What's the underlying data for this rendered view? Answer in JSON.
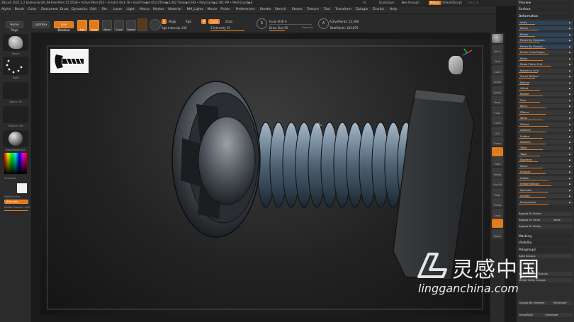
{
  "titlebar": {
    "app": "ZBrush 2021.1.2 boolean/knife_04",
    "stats": "• Free Mem 15.55GB • Active Mem 853 • Scratch Disk 78 • EvalTime▶0.653 ZTime▶1.082 Timer▶0.062 • PolyCount▶2.481 MP • MeshCount▶8",
    "quicksave": "QuickSave",
    "seethrough": "See-through",
    "seethrough_val": "0",
    "menus": "Menus",
    "default_script": "DefaultZScript"
  },
  "menu": [
    "Alpha",
    "Brush",
    "Color",
    "Document",
    "Draw",
    "Dynamics",
    "Edit",
    "File",
    "Layer",
    "Light",
    "Macro",
    "Marker",
    "Material",
    "NM_Lights",
    "Movie",
    "Picker",
    "Preferences",
    "Render",
    "Stencil",
    "Stroke",
    "Texture",
    "Tool",
    "Transform",
    "Zplugin",
    "Zscript",
    "Help"
  ],
  "coords": "-2.941,-0.111,1.456",
  "toolbar": {
    "home_page": "Home Page",
    "lightbox": "LightBox",
    "live_boolean": "Live Boolean",
    "edit": "Edit",
    "draw": "Draw",
    "move": "Move",
    "scale": "Scale",
    "rotate": "Rotate",
    "a": "A",
    "mrgb": "Mrgb",
    "rgb": "Rgb",
    "rgb_intensity": "Rgb Intensity 100",
    "m": "M",
    "zadd": "Zadd",
    "zsub": "Zsub",
    "z_intensity": "Z Intensity 15",
    "focal_shift": "Focal Shift 0",
    "draw_size": "Draw Size 55",
    "dynamic": "Dynamic",
    "active_points": "ActivePoints: 15,398",
    "total_points": "TotalPoints: 183,879"
  },
  "left": {
    "brush": "Move",
    "stroke": "Dots",
    "alpha": "Alpha Off",
    "texture": "Texture Off",
    "material": "BasicMaterial2",
    "gradient": "Gradient",
    "switch_color": "SwitchColor",
    "alternate": "Alternate",
    "model_opacity": "Model Opacity 100"
  },
  "shelf": [
    "BPR",
    "SPix 3",
    "Scroll",
    "Zoom",
    "Actual",
    "AAHalf",
    "Persp",
    "Floor",
    "L.Sym",
    "XYZ",
    "Frame",
    "Move",
    "Scale",
    "Rotate",
    "Line Fill",
    "PolyF",
    "Transp",
    "Ghost",
    "Solo",
    "Xpose"
  ],
  "right": {
    "preview": "Preview",
    "surface": "Surface",
    "deformation": "Deformation",
    "items": [
      "Unify",
      "Mirror",
      "Polish",
      "Polish By Features",
      "Polish By Groups",
      "Polish Crisp Edges",
      "Relax",
      "Relax Plane Grid",
      "Morph to Grid",
      "Smart ReSym",
      "ReSym",
      "Offset",
      "Rotate",
      "Size",
      "Bend",
      "SBend",
      "Skew",
      "SSkew",
      "Aflatten",
      "Flatten",
      "Sflatten",
      "Twist",
      "Taper",
      "Squeeze",
      "Noise",
      "Smooth",
      "Inflate",
      "Inflate Balloon",
      "Spherize",
      "Gravity",
      "Perspective"
    ],
    "repeat_active": "Repeat To Active",
    "repeat_other": "Repeat To Other",
    "mask": "Mask",
    "repeat_folder": "Repeat To Folder",
    "masking": "Masking",
    "visibility": "Visibility",
    "polygroups": "Polygroups",
    "auto_groups": "Auto Groups",
    "merge_similar": "Merge Similar Groups",
    "merge_stray": "Merge Stray Groups",
    "groups_by_normals": "Groups By Normals",
    "maxangle": "MaxAngle",
    "groups_split": "GroupSplit",
    "coverage": "Coverage"
  },
  "watermark": {
    "cn": "灵感中国",
    "url": "lingganchina.com"
  },
  "colors": {
    "accent": "#e07a1a",
    "panel": "#2e2e2e",
    "screw": "#4b5055",
    "thread": "#6b7f92"
  }
}
